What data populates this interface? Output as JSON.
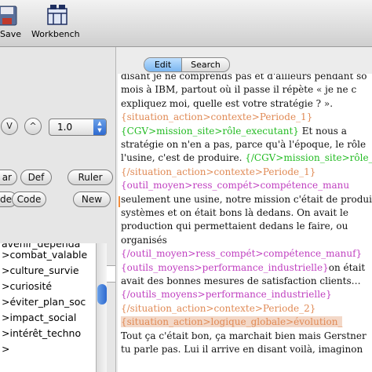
{
  "toolbar": {
    "save_label": "Save",
    "workbench_label": "Workbench"
  },
  "left_pane": {
    "zoom_value": "1.0",
    "round_buttons": [
      "V",
      "^"
    ],
    "buttons": {
      "ar": "ar",
      "def": "Def",
      "ruler": "Ruler",
      "de": "de",
      "code": "Code",
      "new": "New"
    },
    "tag_list": [
      "avenir_dependa",
      ">combat_valable",
      ">culture_survie",
      ">curiosité",
      ">éviter_plan_soc",
      ">impact_social",
      ">intérêt_techno",
      ">"
    ]
  },
  "editor": {
    "tabs": {
      "edit": "Edit",
      "search": "Search"
    },
    "lines": [
      [
        {
          "t": "disant je ne comprends pas et d'ailleurs pendant so",
          "c": ""
        }
      ],
      [
        {
          "t": "mois à IBM, partout où il passe il répète « je ne c",
          "c": ""
        }
      ],
      [
        {
          "t": "expliquez moi, quelle est votre stratégie ? ».",
          "c": ""
        }
      ],
      [
        {
          "t": "{situation_action>contexte>Periode_1}",
          "c": "situ"
        }
      ],
      [
        {
          "t": "{CGV>mission_site>rôle_executant}",
          "c": "cgv"
        },
        {
          "t": " Et nous a",
          "c": ""
        }
      ],
      [
        {
          "t": "stratégie on n'en a pas, parce qu'à l'époque, le rôle",
          "c": ""
        }
      ],
      [
        {
          "t": "l'usine, c'est de produire. ",
          "c": ""
        },
        {
          "t": "{/CGV>mission_site>rôle_e",
          "c": "cgv"
        }
      ],
      [
        {
          "t": "{/situation_action>contexte>Periode_1}",
          "c": "situ"
        }
      ],
      [
        {
          "t": "{outil_moyen>ress_compét>compétence_manu",
          "c": "outil"
        }
      ],
      [
        {
          "t": "seulement une usine, notre mission c'était de produi",
          "c": ""
        }
      ],
      [
        {
          "t": "systèmes et on était bons là dedans. On avait le",
          "c": ""
        }
      ],
      [
        {
          "t": "production qui permettaient dedans le faire, ou",
          "c": ""
        }
      ],
      [
        {
          "t": "organisés",
          "c": ""
        }
      ],
      [
        {
          "t": "{/outil_moyen>ress_compét>compétence_manuf}",
          "c": "outil"
        }
      ],
      [
        {
          "t": "{outils_moyens>performance_industrielle}",
          "c": "outil"
        },
        {
          "t": "on était",
          "c": ""
        }
      ],
      [
        {
          "t": "avait des bonnes mesures de satisfaction clients…",
          "c": ""
        }
      ],
      [
        {
          "t": "{/outils_moyens>performance_industrielle}",
          "c": "outil"
        }
      ],
      [
        {
          "t": "{/situation_action>contexte>Periode_2}",
          "c": "situ"
        }
      ],
      [
        {
          "t": "{situation_action>logique_globale>évolution_",
          "c": "situ"
        }
      ],
      [
        {
          "t": "Tout ça c'était bon, ça marchait bien mais Gerstner",
          "c": ""
        }
      ],
      [
        {
          "t": "tu parle pas. Lui il arrive en disant voilà, imaginon",
          "c": ""
        }
      ]
    ]
  },
  "colors": {
    "situation_tag": "#e08a55",
    "cgv_tag": "#22bb22",
    "outil_tag": "#c040c0",
    "selected_tab": "#7bb6f0"
  }
}
